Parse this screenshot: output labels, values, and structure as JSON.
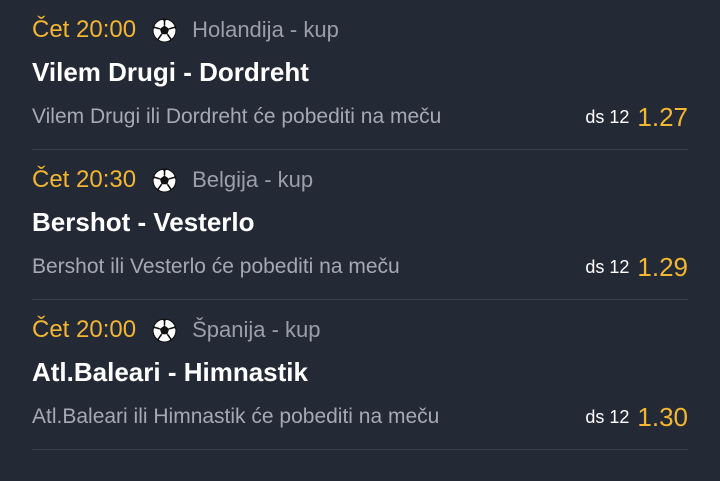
{
  "matches": [
    {
      "time": "Čet 20:00",
      "sport_icon": "soccer-ball-icon",
      "league": "Holandija  -  kup",
      "title": "Vilem Drugi - Dordreht",
      "market": "Vilem Drugi ili Dordreht će pobediti na meču",
      "code": "ds 12",
      "odd": "1.27"
    },
    {
      "time": "Čet 20:30",
      "sport_icon": "soccer-ball-icon",
      "league": "Belgija  -  kup",
      "title": "Bershot - Vesterlo",
      "market": "Bershot ili Vesterlo će pobediti na meču",
      "code": "ds 12",
      "odd": "1.29"
    },
    {
      "time": "Čet 20:00",
      "sport_icon": "soccer-ball-icon",
      "league": "Španija  -  kup",
      "title": "Atl.Baleari - Himnastik",
      "market": "Atl.Baleari ili Himnastik će pobediti na meču",
      "code": "ds 12",
      "odd": "1.30"
    }
  ],
  "colors": {
    "background": "#242936",
    "accent": "#f2b632",
    "secondary_text": "#a4a9b4",
    "divider": "#3b404d"
  }
}
